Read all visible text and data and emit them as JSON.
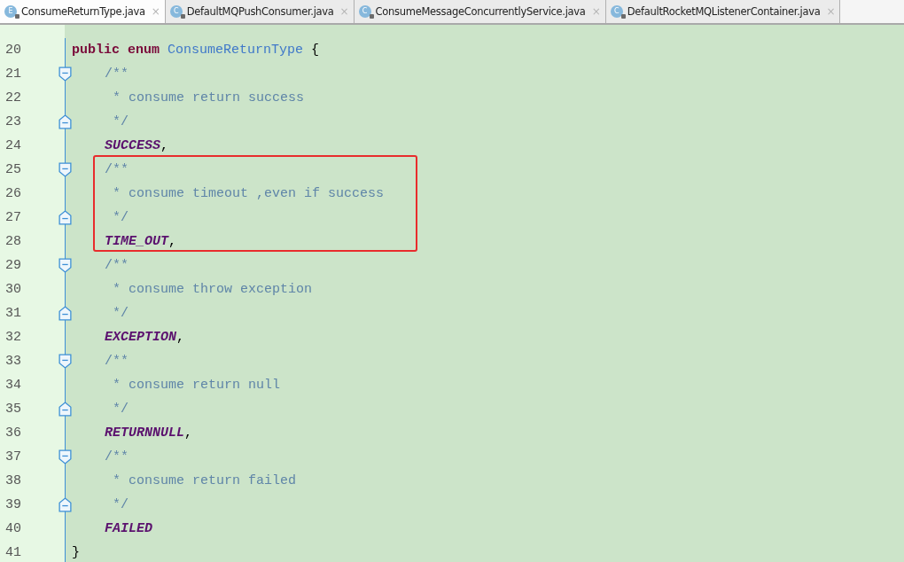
{
  "tabs": [
    {
      "label": "ConsumeReturnType.java",
      "icon_letter": "E",
      "close": "×",
      "selected": true
    },
    {
      "label": "DefaultMQPushConsumer.java",
      "icon_letter": "C",
      "close": "×",
      "selected": false
    },
    {
      "label": "ConsumeMessageConcurrentlyService.java",
      "icon_letter": "C",
      "close": "×",
      "selected": false
    },
    {
      "label": "DefaultRocketMQListenerContainer.java",
      "icon_letter": "C",
      "close": "×",
      "selected": false
    }
  ],
  "lines": [
    {
      "number": "20",
      "kind": "declaration",
      "fold_start": false,
      "fold_end": false,
      "boxed": false,
      "tokens": [
        {
          "kind": "keyword",
          "text": "public enum"
        },
        {
          "kind": "type",
          "text": "ConsumeReturnType"
        },
        {
          "kind": "plain",
          "text": "{"
        }
      ]
    },
    {
      "number": "21",
      "kind": "member",
      "fold_start": true,
      "fold_end": false,
      "boxed": false,
      "tokens": [
        {
          "kind": "comment",
          "text": "/**"
        }
      ]
    },
    {
      "number": "22",
      "kind": "comment_body",
      "fold_start": false,
      "fold_end": false,
      "boxed": false,
      "tokens": [
        {
          "kind": "comment",
          "text": "* consume return success"
        }
      ]
    },
    {
      "number": "23",
      "kind": "comment_body",
      "fold_start": false,
      "fold_end": true,
      "boxed": false,
      "tokens": [
        {
          "kind": "comment",
          "text": "*/"
        }
      ]
    },
    {
      "number": "24",
      "kind": "member",
      "fold_start": false,
      "fold_end": false,
      "boxed": false,
      "tokens": [
        {
          "kind": "constant",
          "text": "SUCCESS"
        },
        {
          "kind": "punct",
          "text": ","
        }
      ]
    },
    {
      "number": "25",
      "kind": "member",
      "fold_start": true,
      "fold_end": false,
      "boxed": true,
      "tokens": [
        {
          "kind": "comment",
          "text": "/**"
        }
      ]
    },
    {
      "number": "26",
      "kind": "comment_body",
      "fold_start": false,
      "fold_end": false,
      "boxed": true,
      "tokens": [
        {
          "kind": "comment",
          "text": "* consume timeout ,even if success"
        }
      ]
    },
    {
      "number": "27",
      "kind": "comment_body",
      "fold_start": false,
      "fold_end": true,
      "boxed": true,
      "tokens": [
        {
          "kind": "comment",
          "text": "*/"
        }
      ]
    },
    {
      "number": "28",
      "kind": "member",
      "fold_start": false,
      "fold_end": false,
      "boxed": true,
      "tokens": [
        {
          "kind": "constant",
          "text": "TIME_OUT"
        },
        {
          "kind": "punct",
          "text": ","
        }
      ]
    },
    {
      "number": "29",
      "kind": "member",
      "fold_start": true,
      "fold_end": false,
      "boxed": false,
      "tokens": [
        {
          "kind": "comment",
          "text": "/**"
        }
      ]
    },
    {
      "number": "30",
      "kind": "comment_body",
      "fold_start": false,
      "fold_end": false,
      "boxed": false,
      "tokens": [
        {
          "kind": "comment",
          "text": "* consume throw exception"
        }
      ]
    },
    {
      "number": "31",
      "kind": "comment_body",
      "fold_start": false,
      "fold_end": true,
      "boxed": false,
      "tokens": [
        {
          "kind": "comment",
          "text": "*/"
        }
      ]
    },
    {
      "number": "32",
      "kind": "member",
      "fold_start": false,
      "fold_end": false,
      "boxed": false,
      "tokens": [
        {
          "kind": "constant",
          "text": "EXCEPTION"
        },
        {
          "kind": "punct",
          "text": ","
        }
      ]
    },
    {
      "number": "33",
      "kind": "member",
      "fold_start": true,
      "fold_end": false,
      "boxed": false,
      "tokens": [
        {
          "kind": "comment",
          "text": "/**"
        }
      ]
    },
    {
      "number": "34",
      "kind": "comment_body",
      "fold_start": false,
      "fold_end": false,
      "boxed": false,
      "tokens": [
        {
          "kind": "comment",
          "text": "* consume return null"
        }
      ]
    },
    {
      "number": "35",
      "kind": "comment_body",
      "fold_start": false,
      "fold_end": true,
      "boxed": false,
      "tokens": [
        {
          "kind": "comment",
          "text": "*/"
        }
      ]
    },
    {
      "number": "36",
      "kind": "member",
      "fold_start": false,
      "fold_end": false,
      "boxed": false,
      "tokens": [
        {
          "kind": "constant",
          "text": "RETURNNULL"
        },
        {
          "kind": "punct",
          "text": ","
        }
      ]
    },
    {
      "number": "37",
      "kind": "member",
      "fold_start": true,
      "fold_end": false,
      "boxed": false,
      "tokens": [
        {
          "kind": "comment",
          "text": "/**"
        }
      ]
    },
    {
      "number": "38",
      "kind": "comment_body",
      "fold_start": false,
      "fold_end": false,
      "boxed": false,
      "tokens": [
        {
          "kind": "comment",
          "text": "* consume return failed"
        }
      ]
    },
    {
      "number": "39",
      "kind": "comment_body",
      "fold_start": false,
      "fold_end": true,
      "boxed": false,
      "tokens": [
        {
          "kind": "comment",
          "text": "*/"
        }
      ]
    },
    {
      "number": "40",
      "kind": "member",
      "fold_start": false,
      "fold_end": false,
      "boxed": false,
      "tokens": [
        {
          "kind": "constant",
          "text": "FAILED"
        }
      ]
    },
    {
      "number": "41",
      "kind": "declaration",
      "fold_start": false,
      "fold_end": false,
      "boxed": false,
      "tokens": [
        {
          "kind": "plain",
          "text": "}"
        }
      ]
    }
  ]
}
